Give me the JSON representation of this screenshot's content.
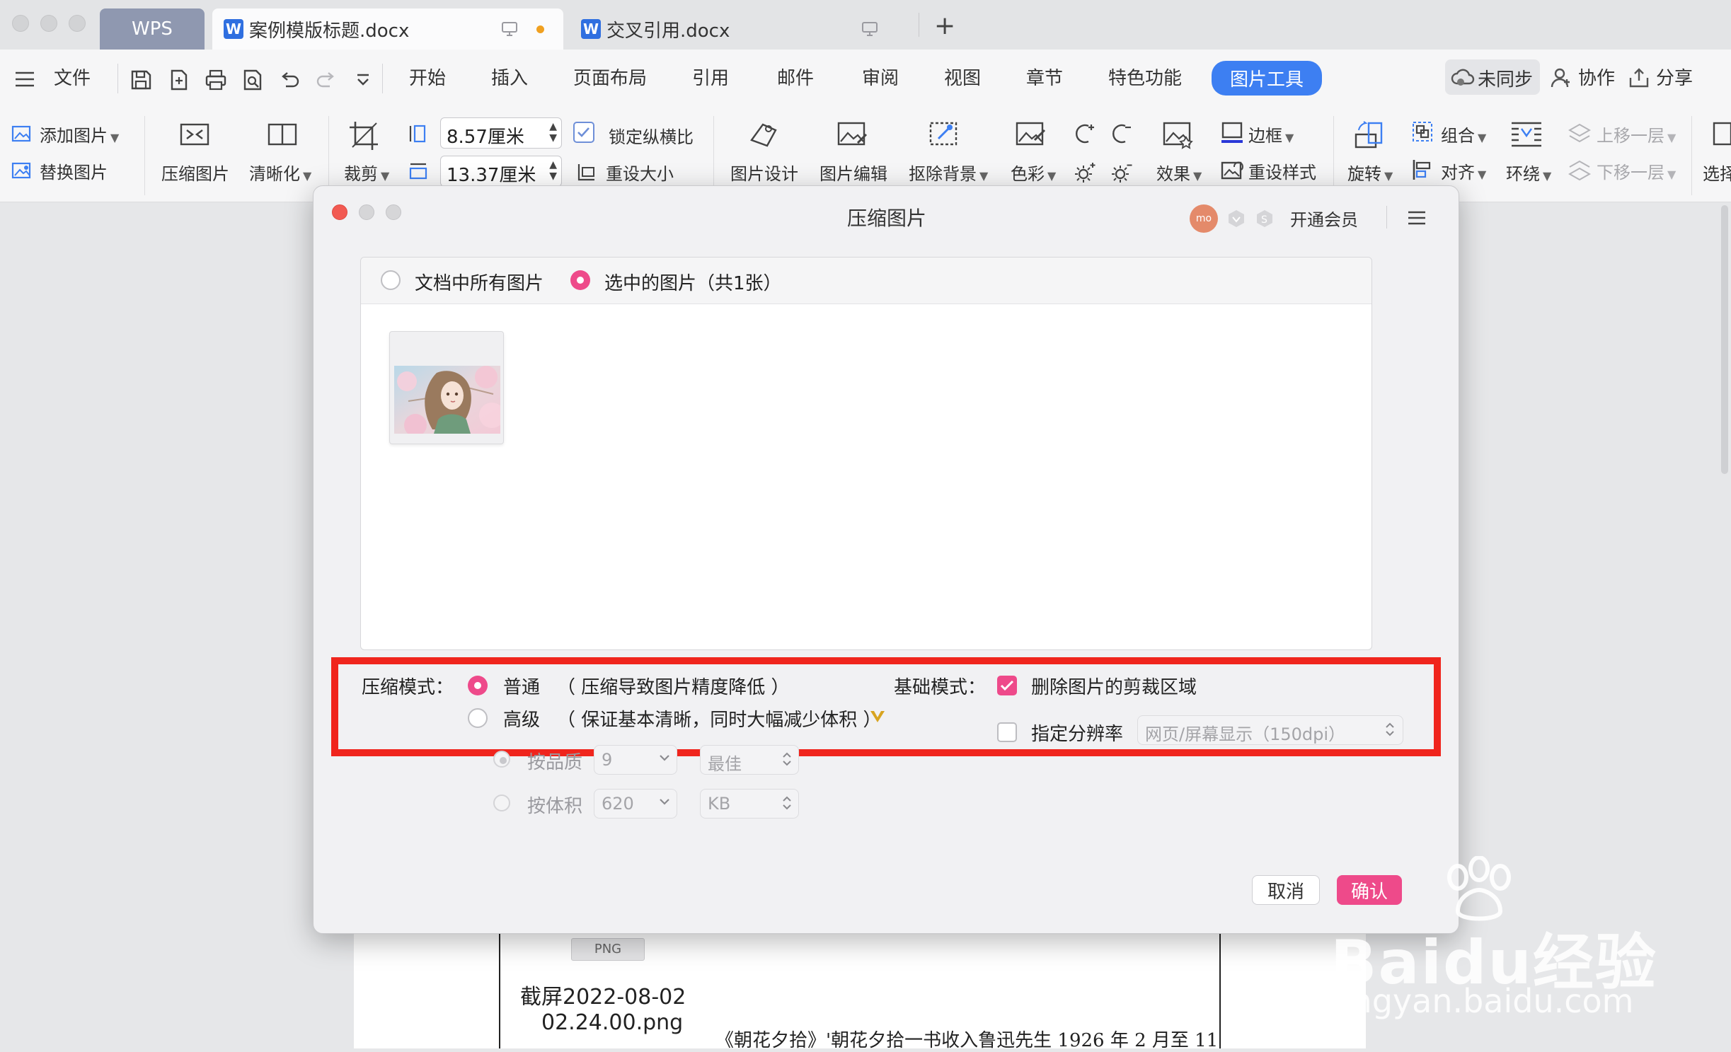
{
  "tabs": {
    "wps": "WPS",
    "doc1": "案例模版标题.docx",
    "doc2": "交叉引用.docx",
    "new_tab": "+"
  },
  "menu": {
    "file": "文件",
    "items": [
      "开始",
      "插入",
      "页面布局",
      "引用",
      "邮件",
      "审阅",
      "视图",
      "章节",
      "特色功能"
    ],
    "active": "图片工具",
    "sync": "未同步",
    "collab": "协作",
    "share": "分享"
  },
  "ribbon": {
    "add_image": "添加图片",
    "replace_image": "替换图片",
    "compress_image": "压缩图片",
    "clarify": "清晰化",
    "crop": "裁剪",
    "height_value": "8.57厘米",
    "width_value": "13.37厘米",
    "lock_ratio": "锁定纵横比",
    "reset_size": "重设大小",
    "image_design": "图片设计",
    "image_edit": "图片编辑",
    "remove_bg": "抠除背景",
    "color": "色彩",
    "effect": "效果",
    "border": "边框",
    "reset_style": "重设样式",
    "rotate": "旋转",
    "group": "组合",
    "align": "对齐",
    "wrap": "环绕",
    "bring_forward": "上移一层",
    "send_backward": "下移一层",
    "select": "选择"
  },
  "dialog": {
    "title": "压缩图片",
    "avatar": "mo",
    "vip": "开通会员",
    "scope_all": "文档中所有图片",
    "scope_selected": "选中的图片（共1张）",
    "compress_mode_label": "压缩模式：",
    "normal": "普通",
    "normal_desc": "（ 压缩导致图片精度降低 ）",
    "advanced": "高级",
    "advanced_desc": "（ 保证基本清晰，同时大幅减少体积 ）",
    "by_quality": "按品质",
    "quality_value": "9",
    "quality_level": "最佳",
    "by_size": "按体积",
    "size_value": "620",
    "size_unit": "KB",
    "basic_mode_label": "基础模式：",
    "delete_crop": "删除图片的剪裁区域",
    "set_resolution": "指定分辨率",
    "resolution_value": "网页/屏幕显示（150dpi）",
    "cancel": "取消",
    "confirm": "确认"
  },
  "document": {
    "badge": "PNG",
    "filename_line1": "截屏2022-08-02",
    "filename_line2": "02.24.00.png",
    "body_text": "《朝花夕拾》'朝花夕拾一书收入鲁迅先生 1926 年 2 月至 11"
  },
  "watermark": {
    "brand": "Baidu经验",
    "url": "jingyan.baidu.com"
  },
  "colors": {
    "accent_blue": "#3d7ff2",
    "accent_pink": "#ee4a8a",
    "highlight_red": "#f0251d"
  }
}
